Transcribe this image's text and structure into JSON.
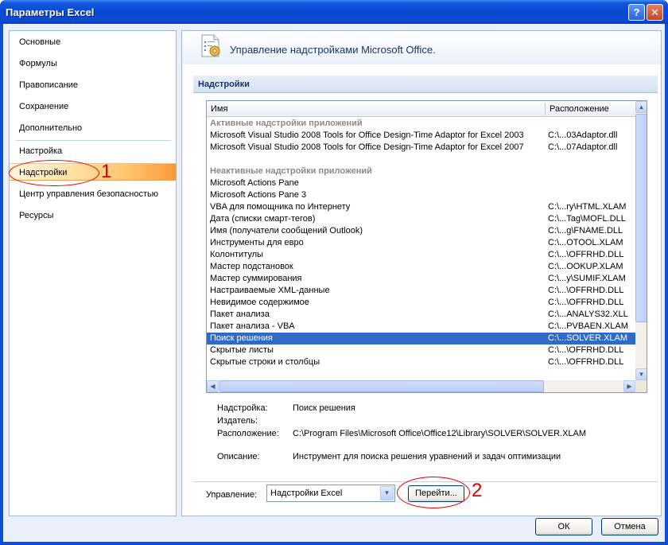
{
  "window": {
    "title": "Параметры Excel",
    "help_glyph": "?",
    "close_glyph": "✕"
  },
  "nav": {
    "items": [
      {
        "label": "Основные"
      },
      {
        "label": "Формулы"
      },
      {
        "label": "Правописание"
      },
      {
        "label": "Сохранение"
      },
      {
        "label": "Дополнительно"
      },
      {
        "label": "Настройка"
      },
      {
        "label": "Надстройки",
        "selected": true
      },
      {
        "label": "Центр управления безопасностью"
      },
      {
        "label": "Ресурсы"
      }
    ]
  },
  "header": {
    "title": "Управление надстройками Microsoft Office.",
    "icon": "addins-gear-icon"
  },
  "section": {
    "title": "Надстройки"
  },
  "list": {
    "col_name": "Имя",
    "col_location": "Расположение",
    "active_group": "Активные надстройки приложений",
    "active": [
      {
        "name": "Microsoft Visual Studio 2008 Tools for Office Design-Time Adaptor for Excel 2003",
        "location": "C:\\...03Adaptor.dll"
      },
      {
        "name": "Microsoft Visual Studio 2008 Tools for Office Design-Time Adaptor for Excel 2007",
        "location": "C:\\...07Adaptor.dll"
      }
    ],
    "inactive_group": "Неактивные надстройки приложений",
    "inactive": [
      {
        "name": "Microsoft Actions Pane",
        "location": ""
      },
      {
        "name": "Microsoft Actions Pane 3",
        "location": ""
      },
      {
        "name": "VBA для помощника по Интернету",
        "location": "C:\\...ry\\HTML.XLAM"
      },
      {
        "name": "Дата (списки смарт-тегов)",
        "location": "C:\\...Tag\\MOFL.DLL"
      },
      {
        "name": "Имя (получатели сообщений Outlook)",
        "location": "C:\\...g\\FNAME.DLL"
      },
      {
        "name": "Инструменты для евро",
        "location": "C:\\...OTOOL.XLAM"
      },
      {
        "name": "Колонтитулы",
        "location": "C:\\...\\OFFRHD.DLL"
      },
      {
        "name": "Мастер подстановок",
        "location": "C:\\...OOKUP.XLAM"
      },
      {
        "name": "Мастер суммирования",
        "location": "C:\\...y\\SUMIF.XLAM"
      },
      {
        "name": "Настраиваемые XML-данные",
        "location": "C:\\...\\OFFRHD.DLL"
      },
      {
        "name": "Невидимое содержимое",
        "location": "C:\\...\\OFFRHD.DLL"
      },
      {
        "name": "Пакет анализа",
        "location": "C:\\...ANALYS32.XLL"
      },
      {
        "name": "Пакет анализа - VBA",
        "location": "C:\\...PVBAEN.XLAM"
      },
      {
        "name": "Поиск решения",
        "location": "C:\\...SOLVER.XLAM",
        "selected": true
      },
      {
        "name": "Скрытые листы",
        "location": "C:\\...\\OFFRHD.DLL"
      },
      {
        "name": "Скрытые строки и столбцы",
        "location": "C:\\...\\OFFRHD.DLL"
      }
    ]
  },
  "details": {
    "addin_label": "Надстройка:",
    "addin_value": "Поиск решения",
    "publisher_label": "Издатель:",
    "publisher_value": "",
    "location_label": "Расположение:",
    "location_value": "C:\\Program Files\\Microsoft Office\\Office12\\Library\\SOLVER\\SOLVER.XLAM",
    "description_label": "Описание:",
    "description_value": "Инструмент для поиска решения уравнений и задач оптимизации"
  },
  "manage": {
    "label": "Управление:",
    "selected": "Надстройки Excel",
    "go_button": "Перейти..."
  },
  "buttons": {
    "ok": "ОК",
    "cancel": "Отмена"
  },
  "annotations": {
    "one": "1",
    "two": "2"
  },
  "colors": {
    "selection": "#316ac5",
    "annotation": "#dd0000",
    "title_bar": "#0a48d0"
  }
}
